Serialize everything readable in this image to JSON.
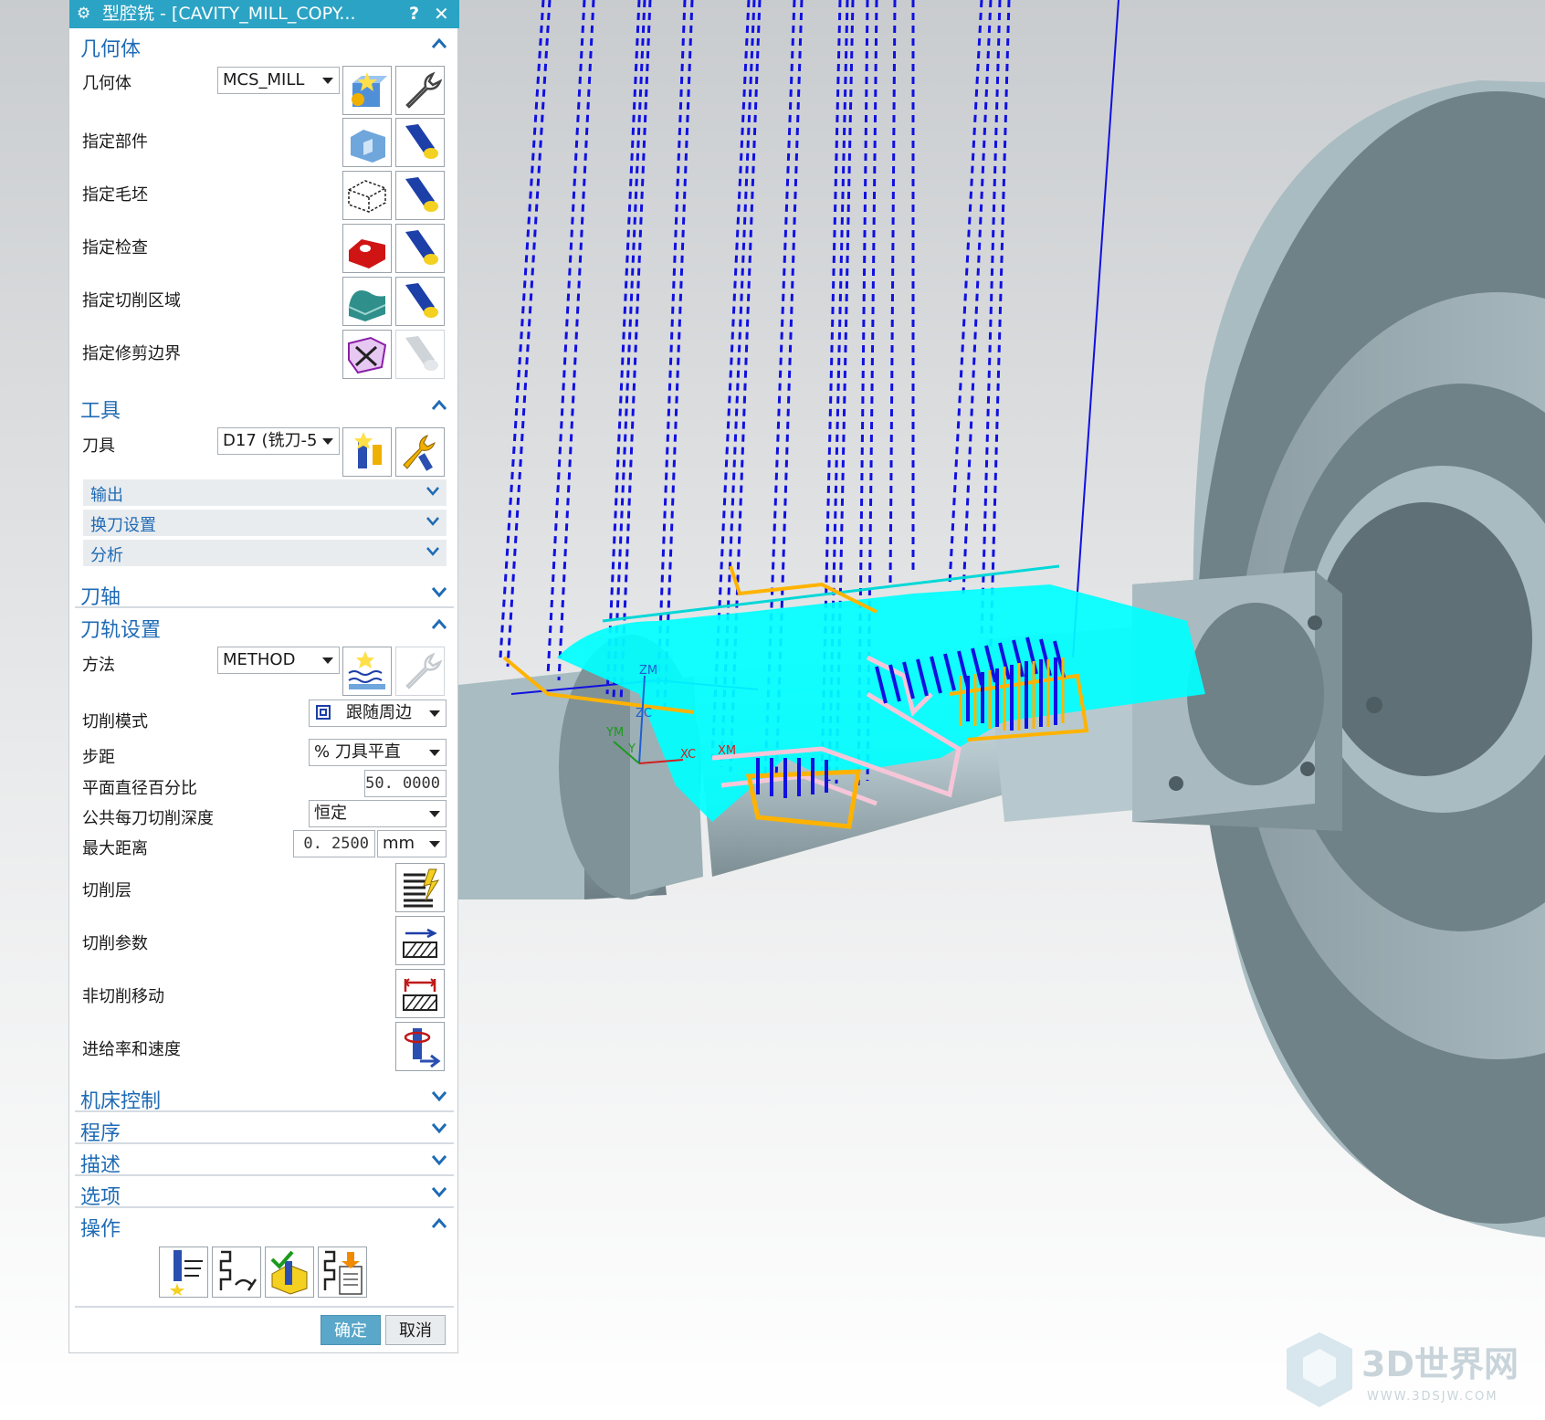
{
  "dialog": {
    "title": "型腔铣 - [CAVITY_MILL_COPY...",
    "help": "?",
    "close": "✕"
  },
  "geometry": {
    "header": "几何体",
    "geometry_label": "几何体",
    "geometry_value": "MCS_MILL",
    "part_label": "指定部件",
    "blank_label": "指定毛坯",
    "check_label": "指定检查",
    "cut_area_label": "指定切削区域",
    "trim_label": "指定修剪边界"
  },
  "tool": {
    "header": "工具",
    "tool_label": "刀具",
    "tool_value": "D17 (铣刀-5",
    "output": "输出",
    "tool_change": "换刀设置",
    "analysis": "分析"
  },
  "tool_axis": {
    "header": "刀轴"
  },
  "path_settings": {
    "header": "刀轨设置",
    "method_label": "方法",
    "method_value": "METHOD",
    "cut_pattern_label": "切削模式",
    "cut_pattern_value": "跟随周边",
    "stepover_label": "步距",
    "stepover_value": "% 刀具平直",
    "flat_pct_label": "平面直径百分比",
    "flat_pct_value": "50. 0000",
    "depth_label": "公共每刀切削深度",
    "depth_value": "恒定",
    "max_dist_label": "最大距离",
    "max_dist_value": "0. 2500",
    "max_dist_unit": "mm",
    "cut_levels_label": "切削层",
    "cut_params_label": "切削参数",
    "non_cut_label": "非切削移动",
    "feeds_label": "进给率和速度"
  },
  "collapsed": {
    "machine_control": "机床控制",
    "program": "程序",
    "description": "描述",
    "options": "选项"
  },
  "actions": {
    "header": "操作"
  },
  "footer": {
    "ok": "确定",
    "cancel": "取消"
  },
  "viewport": {
    "axis_zm": "ZM",
    "axis_zc": "ZC",
    "axis_xc": "XC",
    "axis_xm": "XM",
    "axis_y": "Y",
    "axis_ym": "YM"
  },
  "watermark": {
    "brand": "3D世界网",
    "url": "WWW.3DSJW.COM"
  },
  "colors": {
    "title_bar": "#2ba3c4",
    "section_header": "#1f6bb5",
    "toolpath_blue": "#1010e0",
    "toolpath_cyan": "#00ffff",
    "toolpath_orange": "#ffb300",
    "toolpath_pink": "#f6c6d8",
    "part_gray": "#6f8288",
    "ok_button": "#5aa7c9"
  }
}
